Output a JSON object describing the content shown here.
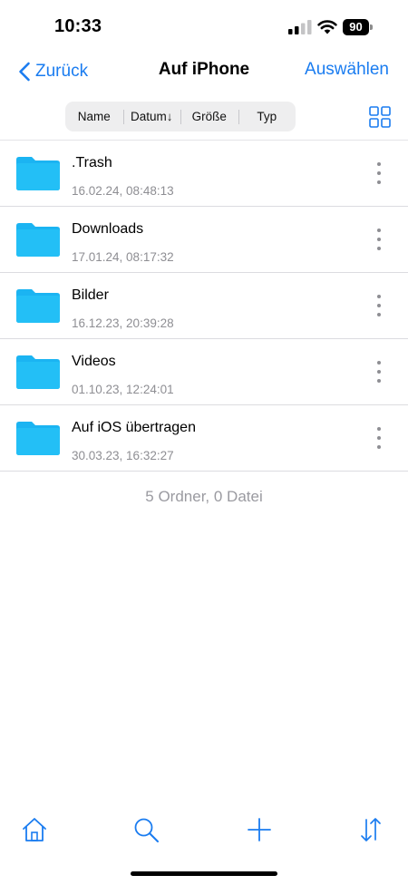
{
  "status_bar": {
    "time": "10:33",
    "battery": "90"
  },
  "nav": {
    "back_label": "Zurück",
    "title": "Auf iPhone",
    "select_label": "Auswählen"
  },
  "sort": {
    "segments": [
      "Name",
      "Datum↓",
      "Größe",
      "Typ"
    ]
  },
  "files": [
    {
      "name": ".Trash",
      "date": "16.02.24, 08:48:13"
    },
    {
      "name": "Downloads",
      "date": "17.01.24, 08:17:32"
    },
    {
      "name": "Bilder",
      "date": "16.12.23, 20:39:28"
    },
    {
      "name": "Videos",
      "date": "01.10.23, 12:24:01"
    },
    {
      "name": "Auf iOS übertragen",
      "date": "30.03.23, 16:32:27"
    }
  ],
  "summary": "5 Ordner, 0 Datei",
  "colors": {
    "accent": "#1a7cf0",
    "folder": "#1bb4f2",
    "secondary_text": "#8e8e93"
  },
  "toolbar": {
    "icons": [
      "home-icon",
      "search-icon",
      "plus-icon",
      "sort-arrows-icon"
    ]
  }
}
